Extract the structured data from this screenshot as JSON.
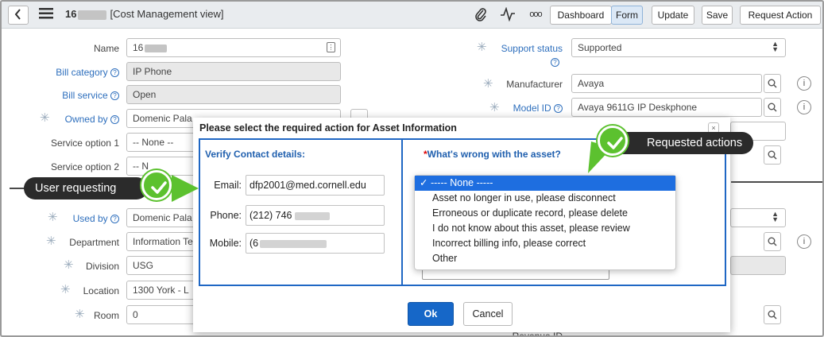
{
  "header": {
    "title_prefix": "16",
    "title_suffix": "[Cost Management view]",
    "buttons": {
      "dashboard": "Dashboard",
      "form": "Form",
      "update": "Update",
      "save": "Save",
      "request_action": "Request Action"
    },
    "more": "ooo"
  },
  "form": {
    "name_label": "Name",
    "name_value": "16",
    "bill_category_label": "Bill category",
    "bill_category_value": "IP Phone",
    "bill_service_label": "Bill service",
    "bill_service_value": "Open",
    "owned_by_label": "Owned by",
    "owned_by_value": "Domenic Pala",
    "service_option1_label": "Service option 1",
    "service_option1_value": "-- None --",
    "service_option2_label": "Service option 2",
    "service_option2_value": "-- N",
    "used_by_label": "Used by",
    "used_by_value": "Domenic Pala",
    "department_label": "Department",
    "department_value": "Information Te",
    "division_label": "Division",
    "division_value": "USG",
    "location_label": "Location",
    "location_value": "1300 York - L",
    "room_label": "Room",
    "room_value": "0",
    "support_status_label": "Support status",
    "support_status_value": "Supported",
    "manufacturer_label": "Manufacturer",
    "manufacturer_value": "Avaya",
    "model_id_label": "Model ID",
    "model_id_value": "Avaya 9611G IP Deskphone",
    "revenue_label": "Revenue ID"
  },
  "modal": {
    "title": "Please select the required action for Asset Information",
    "left_heading": "Verify Contact details:",
    "email_label": "Email:",
    "email_value": "dfp2001@med.cornell.edu",
    "phone_label": "Phone:",
    "phone_value": "(212) 746",
    "mobile_label": "Mobile:",
    "mobile_value": "(6",
    "right_heading": "What's wrong with the asset?",
    "required_mark": "*",
    "options": [
      "----- None -----",
      "Asset no longer in use, please disconnect",
      "Erroneous or duplicate record, please delete",
      "I do not know about this asset, please review",
      "Incorrect billing info, please correct",
      "Other"
    ],
    "selected_mark": "✓",
    "ok": "Ok",
    "cancel": "Cancel"
  },
  "callouts": {
    "user_requesting": "User requesting",
    "requested_actions": "Requested actions"
  },
  "colors": {
    "accent": "#1f67c4",
    "callout_green": "#5cc12f",
    "callout_bg": "#2b2b2b",
    "link": "#2e6fbd"
  }
}
